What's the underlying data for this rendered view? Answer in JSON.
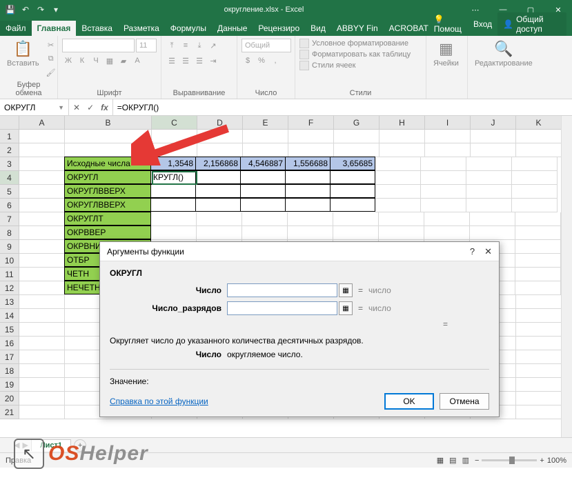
{
  "title": "округление.xlsx - Excel",
  "tabs": {
    "file": "Файл",
    "home": "Главная",
    "insert": "Вставка",
    "layout": "Разметка",
    "formulas": "Формулы",
    "data": "Данные",
    "review": "Рецензиро",
    "view": "Вид",
    "abbyy": "ABBYY Fin",
    "acrobat": "ACROBAT",
    "help": "Помощ",
    "signin": "Вход",
    "share": "Общий доступ"
  },
  "ribbon": {
    "clipboard": {
      "paste": "Вставить",
      "label": "Буфер обмена"
    },
    "font": {
      "label": "Шрифт",
      "size": "11",
      "bold": "Ж",
      "italic": "К",
      "underline": "Ч"
    },
    "align": {
      "label": "Выравнивание"
    },
    "number": {
      "label": "Число",
      "format": "Общий"
    },
    "styles": {
      "label": "Стили",
      "cond": "Условное форматирование",
      "table": "Форматировать как таблицу",
      "cell": "Стили ячеек"
    },
    "cells": {
      "label": "Ячейки"
    },
    "editing": {
      "label": "Редактирование"
    }
  },
  "namebox": "ОКРУГЛ",
  "formula": "=ОКРУГЛ()",
  "columns": [
    "A",
    "B",
    "C",
    "D",
    "E",
    "F",
    "G",
    "H",
    "I",
    "J",
    "K"
  ],
  "sheet": {
    "b3": "Исходные числа",
    "c3": "1,3548",
    "d3": "2,156868",
    "e3": "4,546887",
    "f3": "1,556688",
    "g3": "3,65685",
    "b4": "ОКРУГЛ",
    "c4": "КРУГЛ()",
    "b5": "ОКРУГЛВВЕРХ",
    "b6": "ОКРУГЛВВЕРХ",
    "b7": "ОКРУГЛТ",
    "b8": "ОКРВВЕР",
    "b9": "ОКРВНИ",
    "b10": "ОТБР",
    "b11": "ЧЕТН",
    "b12": "НЕЧЕТН"
  },
  "dialog": {
    "title": "Аргументы функции",
    "fname": "ОКРУГЛ",
    "arg1": "Число",
    "arg2": "Число_разрядов",
    "type": "число",
    "eq": "=",
    "desc": "Округляет число до указанного количества десятичных разрядов.",
    "argd_label": "Число",
    "argd_text": "округляемое число.",
    "result": "Значение:",
    "help": "Справка по этой функции",
    "ok": "OK",
    "cancel": "Отмена"
  },
  "sheettab": "Лист1",
  "status": {
    "mode": "Правка",
    "zoom": "100%"
  },
  "logo": {
    "os": "OS",
    "helper": "Helper"
  }
}
